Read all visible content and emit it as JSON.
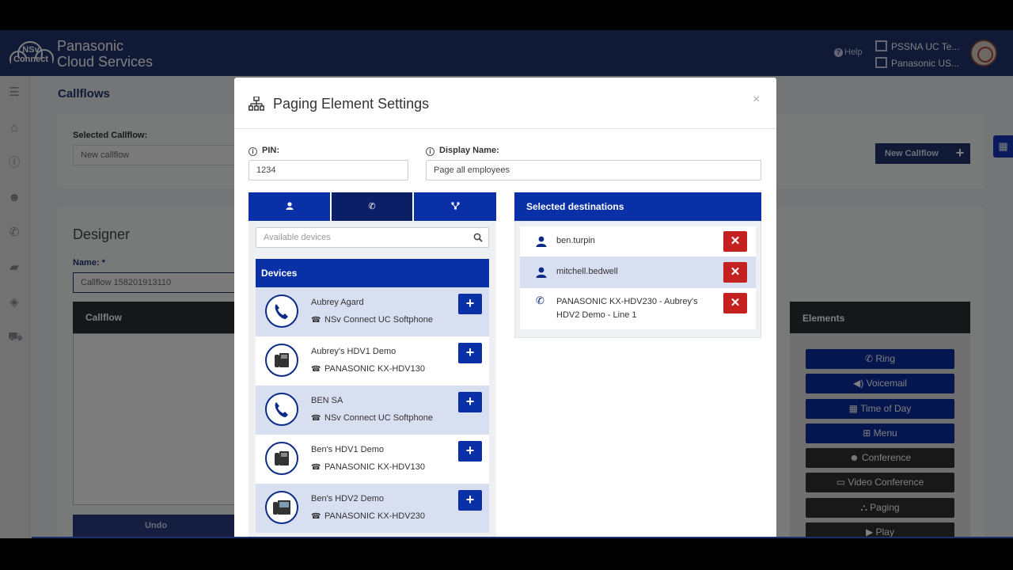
{
  "header": {
    "logo_line1": "NSv",
    "logo_line2": "Connect",
    "brand_line1": "Panasonic",
    "brand_line2": "Cloud Services",
    "help_label": "Help",
    "org1": "PSSNA UC Te...",
    "org2": "Panasonic US..."
  },
  "page": {
    "title": "Callflows",
    "selected_callflow_label": "Selected Callflow:",
    "selected_callflow_value": "New callflow",
    "new_callflow_label": "New Callflow",
    "designer_title": "Designer",
    "name_label": "Name: *",
    "name_value": "Callflow 158201913110",
    "callflow_panel_title": "Callflow",
    "undo_label": "Undo",
    "elements_title": "Elements",
    "elements": [
      "Ring",
      "Voicemail",
      "Time of Day",
      "Menu",
      "Conference",
      "Video Conference",
      "Paging",
      "Play"
    ]
  },
  "modal": {
    "title": "Paging Element Settings",
    "close": "×",
    "pin_label": "PIN:",
    "pin_value": "1234",
    "display_name_label": "Display Name:",
    "display_name_value": "Page all employees",
    "search_placeholder": "Available devices",
    "devices_header": "Devices",
    "devices": [
      {
        "name": "Aubrey Agard",
        "type": "NSv Connect UC Softphone",
        "icon": "handset-icon"
      },
      {
        "name": "Aubrey's HDV1 Demo",
        "type": "PANASONIC KX-HDV130",
        "icon": "desk-phone-icon"
      },
      {
        "name": "BEN SA",
        "type": "NSv Connect UC Softphone",
        "icon": "handset-icon"
      },
      {
        "name": "Ben's HDV1 Demo",
        "type": "PANASONIC KX-HDV130",
        "icon": "desk-phone-icon"
      },
      {
        "name": "Ben's HDV2 Demo",
        "type": "PANASONIC KX-HDV230",
        "icon": "desk-phone-icon"
      }
    ],
    "selected_header": "Selected destinations",
    "selected": [
      {
        "line1": "ben.turpin",
        "line2": "",
        "icon": "user-icon"
      },
      {
        "line1": "mitchell.bedwell",
        "line2": "",
        "icon": "user-icon"
      },
      {
        "line1": "PANASONIC KX-HDV230 - Aubrey's",
        "line2": "HDV2 Demo - Line 1",
        "icon": "phone-icon"
      }
    ],
    "add_symbol": "+",
    "remove_symbol": "✕"
  },
  "colors": {
    "header_bg": "#21346e",
    "primary_blue": "#0a30a8",
    "active_tab": "#0b1f66",
    "danger": "#c62121",
    "row_alt": "#d7dff1"
  }
}
